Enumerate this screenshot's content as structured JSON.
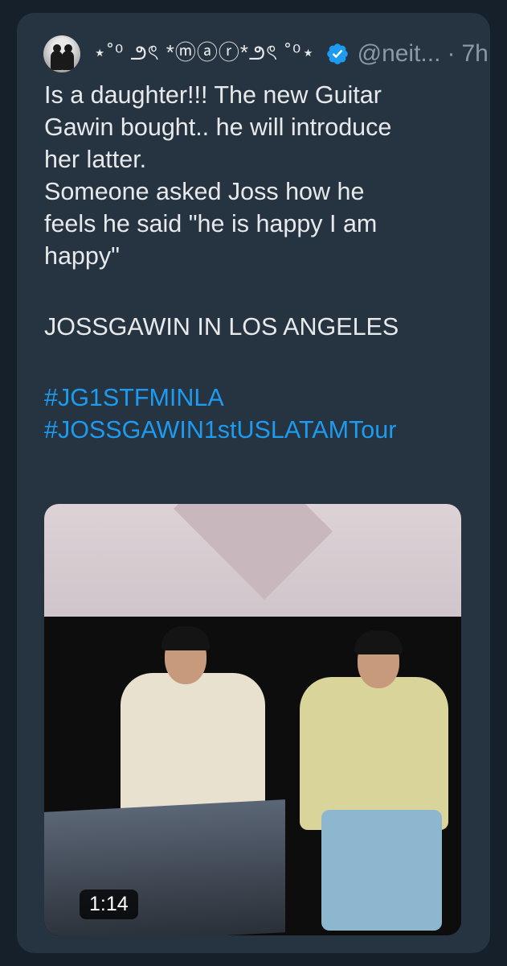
{
  "tweet": {
    "display_name": "⋆˚⁰ ౨ৎ *ⓜⓐⓡ*౨ৎ ˚⁰⋆",
    "handle": "@neit...",
    "separator": "·",
    "time": "7h",
    "lines": [
      "Is a daughter!!! The new Guitar",
      "Gawin bought.. he will introduce",
      "her latter.",
      "Someone asked Joss how he",
      "feels he said \"he is happy I am",
      "happy\""
    ],
    "headline": "JOSSGAWIN IN LOS ANGELES",
    "hashtags": [
      "#JG1STFMINLA",
      "#JOSSGAWIN1stUSLATAMTour"
    ],
    "media": {
      "duration": "1:14"
    }
  },
  "colors": {
    "background": "#15202b",
    "card": "#263340",
    "text": "#e7e9ea",
    "secondary_text": "#8b98a5",
    "link": "#1d9bf0",
    "verified": "#1d9bf0"
  }
}
